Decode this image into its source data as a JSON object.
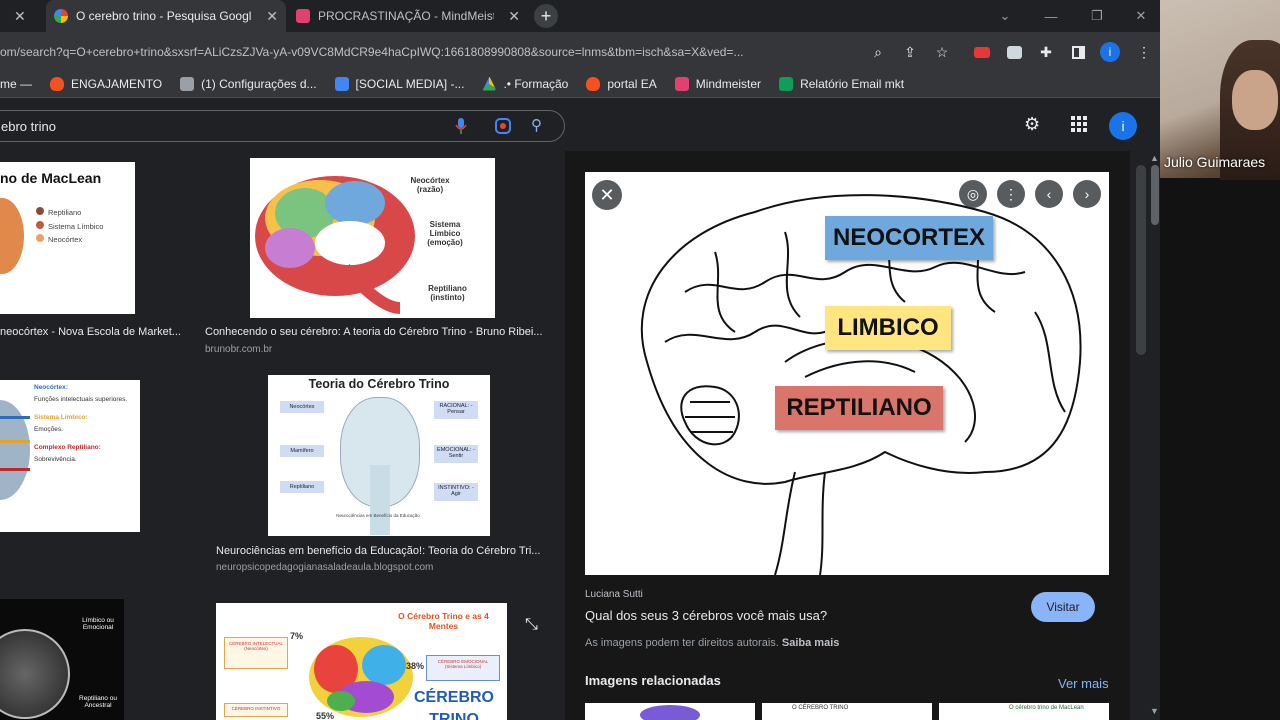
{
  "browser": {
    "tabs": [
      {
        "title": "O cerebro trino - Pesquisa Googl",
        "close": "✕"
      },
      {
        "title": "PROCRASTINAÇÃO - MindMeist",
        "close": "✕"
      }
    ],
    "new_tab": "+",
    "url": "om/search?q=O+cerebro+trino&sxsrf=ALiCzsZJVa-yA-v09VC8MdCR9e4haCpIWQ:1661808990808&source=lnms&tbm=isch&sa=X&ved=...",
    "bookmarks": [
      "me —",
      "ENGAJAMENTO",
      "(1) Configurações d...",
      "[SOCIAL MEDIA] -...",
      ".• Formação",
      "portal EA",
      "Mindmeister",
      "Relatório Email mkt"
    ]
  },
  "google": {
    "query": "ebro trino",
    "account_initial": "i"
  },
  "results": [
    {
      "title": "no de MacLean",
      "legend": [
        "Reptiliano",
        "Sistema Límbico",
        "Neocórtex"
      ],
      "caption": "neocórtex - Nova Escola de Market..."
    },
    {
      "labels": [
        "Neocórtex (razão)",
        "Sistema Límbico (emoção)",
        "Reptiliano (instinto)"
      ],
      "caption": "Conhecendo o seu cérebro: A teoria do Cérebro Trino - Bruno Ribei...",
      "source": "brunobr.com.br"
    },
    {
      "lines": [
        "Neocórtex:",
        "Funções intelectuais superiores.",
        "Sistema Límbico:",
        "Emoções.",
        "Complexo Reptiliano:",
        "Sobrevivência."
      ]
    },
    {
      "title": "Teoria do Cérebro Trino",
      "left": [
        "Neocórtex",
        "Mamífero",
        "Reptiliano"
      ],
      "right": [
        "RACIONAL: - Pensar",
        "EMOCIONAL: - Sentir",
        "INSTINTIVO: - Agir"
      ],
      "footer": "Neurociências em Benefício da Educação",
      "caption": "Neurociências em benefício da Educação!: Teoria do Cérebro Tri...",
      "source": "neuropsicopedagogianasaladeaula.blogspot.com"
    },
    {
      "labels": [
        "Límbico ou Emocional",
        "Reptiliano ou Ancestral"
      ]
    },
    {
      "title": "O Cérebro Trino e as 4 Mentes",
      "pct1": "7%",
      "pct2": "38%",
      "pct3": "55%",
      "big": "CÉREBRO TRINO",
      "boxes": [
        "CÉREBRO INTELECTUAL (Neocórtex)",
        "CÉREBRO EMOCIONAL (Sistema Límbico)",
        "CÉREBRO INSTINTIVO"
      ]
    }
  ],
  "preview": {
    "labels": {
      "neocortex": "NEOCORTEX",
      "limbico": "LIMBICO",
      "reptiliano": "REPTILIANO"
    },
    "author": "Luciana Sutti",
    "title": "Qual dos seus 3 cérebros você mais usa?",
    "rights": "As imagens podem ter direitos autorais.",
    "learn_more": "Saiba mais",
    "visit": "Visitar",
    "related": "Imagens relacionadas",
    "see_more": "Ver mais",
    "related_thumb_texts": [
      "O CÉREBRO TRINO",
      "O cérebro trino de MacLean"
    ]
  },
  "participant": {
    "name": "Julio Guimaraes"
  },
  "colors": {
    "label_blue": "#6fa8dc",
    "label_yellow": "#ffe680",
    "label_red": "#d9756b",
    "accent": "#8ab4f8"
  }
}
